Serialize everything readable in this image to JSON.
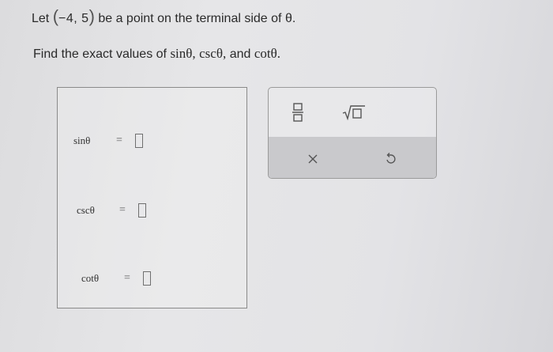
{
  "problem": {
    "line1_prefix": "Let",
    "point": "−4, 5",
    "line1_suffix": "be a point on the terminal side of θ.",
    "line2_prefix": "Find the exact values of",
    "fn1": "sinθ,",
    "fn2": "cscθ,",
    "line2_and": "and",
    "fn3": "cotθ."
  },
  "answers": [
    {
      "label": "sinθ",
      "equals": "=",
      "value": ""
    },
    {
      "label": "cscθ",
      "equals": "=",
      "value": ""
    },
    {
      "label": "cotθ",
      "equals": "=",
      "value": ""
    }
  ],
  "toolbar": {
    "fraction_icon": "fraction-icon",
    "sqrt_icon": "square-root-icon",
    "clear_icon": "x-icon",
    "undo_icon": "undo-icon"
  },
  "colors": {
    "text": "#2a2a2a",
    "toolbar_bottom": "#c9c9cc"
  }
}
